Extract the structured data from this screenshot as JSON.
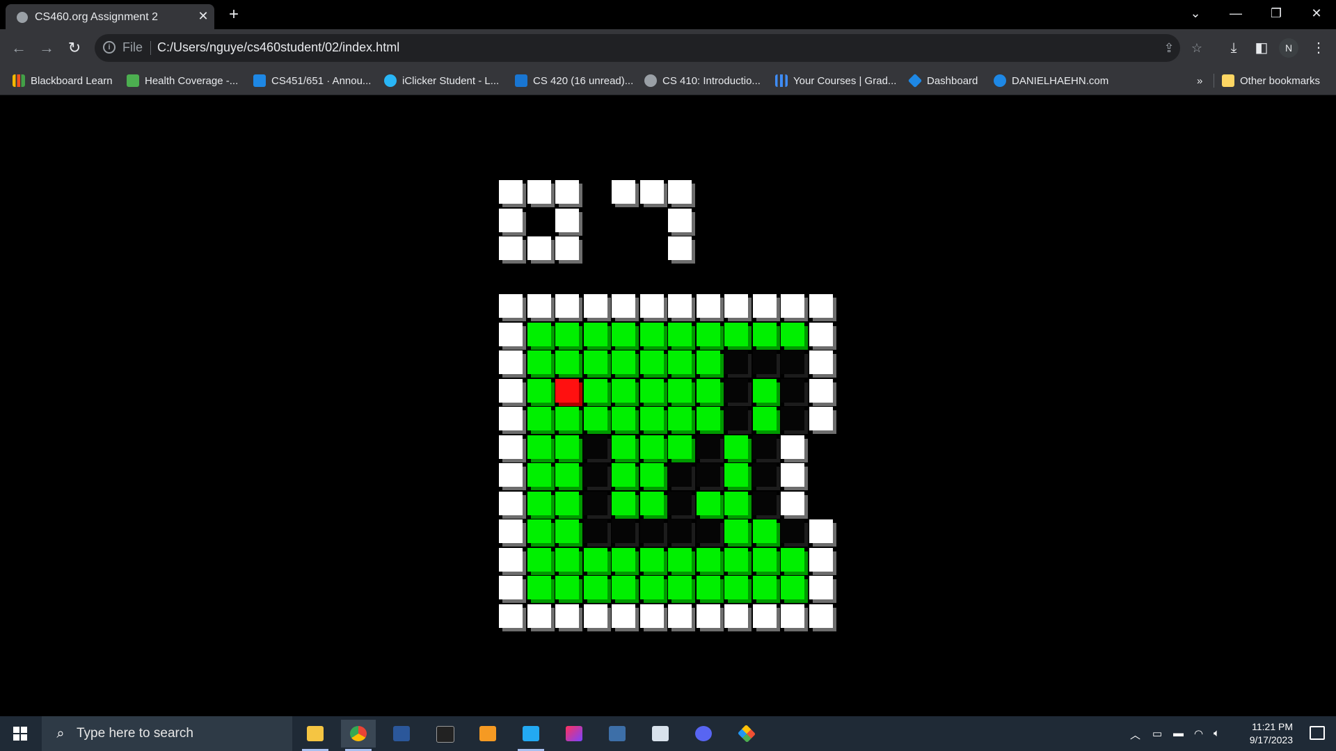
{
  "tab": {
    "title": "CS460.org Assignment 2"
  },
  "toolbar": {
    "scheme_label": "File",
    "url": "C:/Users/nguye/cs460student/02/index.html",
    "avatar": "N"
  },
  "bookmarks": [
    {
      "label": "Blackboard Learn",
      "color": "#f5b800"
    },
    {
      "label": "Health Coverage -...",
      "color": "#4caf50"
    },
    {
      "label": "CS451/651 · Annou...",
      "color": "#1e88e5"
    },
    {
      "label": "iClicker Student - L...",
      "color": "#29b6f6"
    },
    {
      "label": "CS 420 (16 unread)...",
      "color": "#1976d2"
    },
    {
      "label": "CS 410: Introductio...",
      "color": "#9aa0a6"
    },
    {
      "label": "Your Courses | Grad...",
      "color": "#3f8cf4"
    },
    {
      "label": "Dashboard",
      "color": "#1e88e5"
    },
    {
      "label": "DANIELHAEHN.com",
      "color": "#1e88e5"
    }
  ],
  "bookmarks_overflow": "»",
  "other_bookmarks": "Other bookmarks",
  "taskbar": {
    "search_placeholder": "Type here to search",
    "time": "11:21 PM",
    "date": "9/17/2023"
  },
  "pixel_art": {
    "legend": {
      "W": "white",
      "G": "green",
      "R": "red",
      "B": "black",
      ".": "empty"
    },
    "top_rows": [
      "WWW.WWW",
      "W.W...W",
      "WWW...W"
    ],
    "grid_rows": [
      "WWWWWWWWWWWW",
      "WGGGGGGGGGGW",
      "WGGGGGGGBBBW",
      "WGRGGGGGBGBW",
      "WGGGGGGGBGBW",
      "WGGBGGGBGBW",
      "WGGBGGBBGBW",
      "WGGBGGBGGBW",
      "WGGBBBBBGGBW",
      "WGGGGGGGGGGW",
      "WGGGGGGGGGGW",
      "WWWWWWWWWWWW"
    ]
  }
}
